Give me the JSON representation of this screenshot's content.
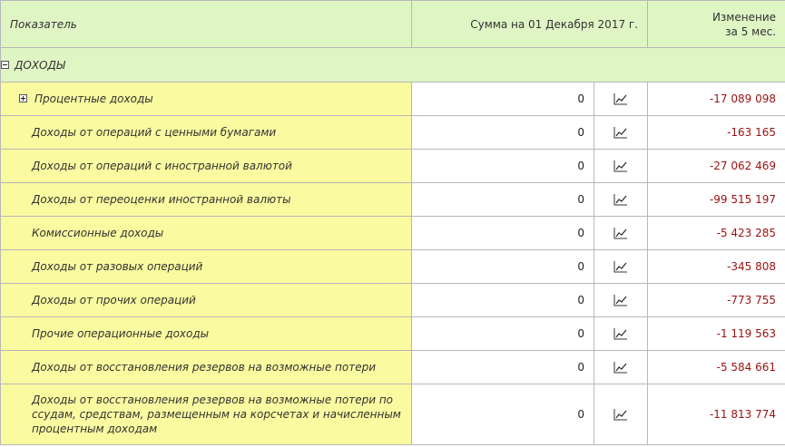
{
  "header": {
    "indicator": "Показатель",
    "sum": "Сумма на 01 Декабря 2017 г.",
    "change_line1": "Изменение",
    "change_line2": "за 5 мес."
  },
  "section": {
    "title": "ДОХОДЫ"
  },
  "rows": [
    {
      "label": "Процентные доходы",
      "value": "0",
      "change": "-17 089 098",
      "expandable": true
    },
    {
      "label": "Доходы от операций с ценными бумагами",
      "value": "0",
      "change": "-163 165"
    },
    {
      "label": "Доходы от операций с иностранной валютой",
      "value": "0",
      "change": "-27 062 469"
    },
    {
      "label": "Доходы от переоценки иностранной валюты",
      "value": "0",
      "change": "-99 515 197"
    },
    {
      "label": "Комиссионные доходы",
      "value": "0",
      "change": "-5 423 285"
    },
    {
      "label": "Доходы от разовых операций",
      "value": "0",
      "change": "-345 808"
    },
    {
      "label": "Доходы от прочих операций",
      "value": "0",
      "change": "-773 755"
    },
    {
      "label": "Прочие операционные доходы",
      "value": "0",
      "change": "-1 119 563"
    },
    {
      "label": "Доходы от восстановления резервов на возможные потери",
      "value": "0",
      "change": "-5 584 661"
    },
    {
      "label": "Доходы от восстановления резервов на возможные потери по ссудам, средствам, размещенным на корсчетах и начисленным процентным доходам",
      "value": "0",
      "change": "-11 813 774"
    }
  ],
  "icons": {
    "chart": "chart-line-icon",
    "collapse": "minus-box-icon",
    "expand": "plus-box-icon"
  },
  "colors": {
    "header_bg": "#dff5c4",
    "label_bg": "#fafaa0",
    "negative": "#9c1111",
    "border": "#b8b8b8"
  }
}
